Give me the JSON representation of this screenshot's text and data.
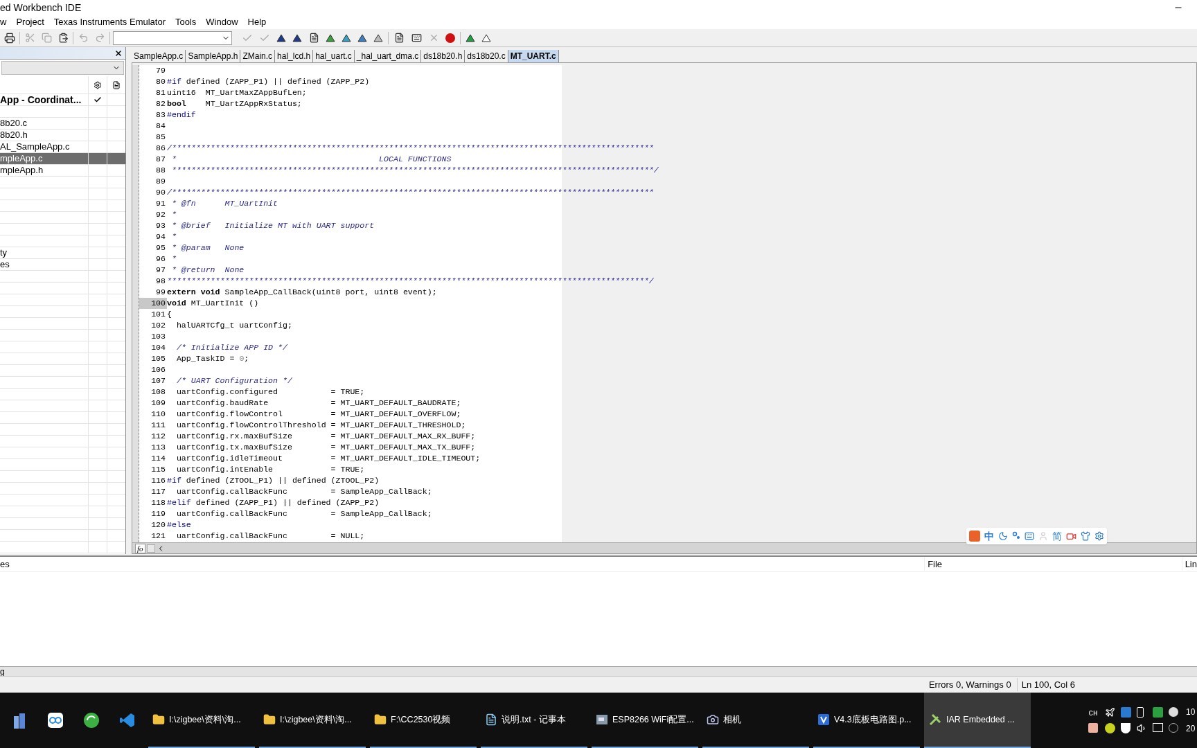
{
  "window": {
    "title": "ed Workbench IDE"
  },
  "menu": [
    "w",
    "Project",
    "Texas Instruments Emulator",
    "Tools",
    "Window",
    "Help"
  ],
  "workspace": {
    "project": {
      "label": "App - Coordinat...",
      "checked": true
    },
    "items": [
      {
        "label": "8b20.c",
        "selected": false
      },
      {
        "label": "8b20.h",
        "selected": false
      },
      {
        "label": "AL_SampleApp.c",
        "selected": false
      },
      {
        "label": "mpleApp.c",
        "selected": true
      },
      {
        "label": "mpleApp.h",
        "selected": false
      },
      {
        "label": "ty",
        "selected": false
      },
      {
        "label": "es",
        "selected": false
      }
    ]
  },
  "tabs": [
    {
      "label": "SampleApp.c",
      "selected": false
    },
    {
      "label": "SampleApp.h",
      "selected": false
    },
    {
      "label": "ZMain.c",
      "selected": false
    },
    {
      "label": "hal_lcd.h",
      "selected": false
    },
    {
      "label": "hal_uart.c",
      "selected": false
    },
    {
      "label": "_hal_uart_dma.c",
      "selected": false
    },
    {
      "label": "ds18b20.h",
      "selected": false
    },
    {
      "label": "ds18b20.c",
      "selected": false
    },
    {
      "label": "MT_UART.c",
      "selected": true
    }
  ],
  "code": [
    {
      "number": "79",
      "current": false
    },
    {
      "number": "80",
      "current": false,
      "parts": [
        {
          "kind": "directive",
          "text": "#if"
        },
        {
          "kind": "plain",
          "text": " defined (ZAPP_P1) || defined (ZAPP_P2)"
        }
      ]
    },
    {
      "number": "81",
      "current": false,
      "parts": [
        {
          "kind": "plain",
          "text": "uint16  MT_UartMaxZAppBufLen;"
        }
      ]
    },
    {
      "number": "82",
      "current": false,
      "parts": [
        {
          "kind": "keyword",
          "text": "bool"
        },
        {
          "kind": "plain",
          "text": "    MT_UartZAppRxStatus;"
        }
      ]
    },
    {
      "number": "83",
      "current": false,
      "parts": [
        {
          "kind": "directive",
          "text": "#endif"
        }
      ]
    },
    {
      "number": "84",
      "current": false
    },
    {
      "number": "85",
      "current": false
    },
    {
      "number": "86",
      "current": false,
      "parts": [
        {
          "kind": "comment",
          "text": "/****************************************************************************************************"
        }
      ]
    },
    {
      "number": "87",
      "current": false,
      "parts": [
        {
          "kind": "comment",
          "text": " *                                          LOCAL FUNCTIONS"
        }
      ]
    },
    {
      "number": "88",
      "current": false,
      "parts": [
        {
          "kind": "comment",
          "text": " ****************************************************************************************************/"
        }
      ]
    },
    {
      "number": "89",
      "current": false
    },
    {
      "number": "90",
      "current": false,
      "parts": [
        {
          "kind": "comment",
          "text": "/****************************************************************************************************"
        }
      ]
    },
    {
      "number": "91",
      "current": false,
      "parts": [
        {
          "kind": "comment",
          "text": " * @fn      MT_UartInit"
        }
      ]
    },
    {
      "number": "92",
      "current": false,
      "parts": [
        {
          "kind": "comment",
          "text": " *"
        }
      ]
    },
    {
      "number": "93",
      "current": false,
      "parts": [
        {
          "kind": "comment",
          "text": " * @brief   Initialize MT with UART support"
        }
      ]
    },
    {
      "number": "94",
      "current": false,
      "parts": [
        {
          "kind": "comment",
          "text": " *"
        }
      ]
    },
    {
      "number": "95",
      "current": false,
      "parts": [
        {
          "kind": "comment",
          "text": " * @param   None"
        }
      ]
    },
    {
      "number": "96",
      "current": false,
      "parts": [
        {
          "kind": "comment",
          "text": " *"
        }
      ]
    },
    {
      "number": "97",
      "current": false,
      "parts": [
        {
          "kind": "comment",
          "text": " * @return  None"
        }
      ]
    },
    {
      "number": "98",
      "current": false,
      "parts": [
        {
          "kind": "comment",
          "text": "****************************************************************************************************/"
        }
      ]
    },
    {
      "number": "99",
      "current": false,
      "parts": [
        {
          "kind": "keyword",
          "text": "extern void"
        },
        {
          "kind": "plain",
          "text": " SampleApp_CallBack(uint8 port, uint8 event);"
        }
      ]
    },
    {
      "number": "100",
      "current": true,
      "parts": [
        {
          "kind": "keyword",
          "text": "void"
        },
        {
          "kind": "plain",
          "text": " MT_UartInit ()"
        }
      ]
    },
    {
      "number": "101",
      "current": false,
      "parts": [
        {
          "kind": "plain",
          "text": "{"
        }
      ]
    },
    {
      "number": "102",
      "current": false,
      "parts": [
        {
          "kind": "plain",
          "text": "  halUARTCfg_t uartConfig;"
        }
      ]
    },
    {
      "number": "103",
      "current": false
    },
    {
      "number": "104",
      "current": false,
      "parts": [
        {
          "kind": "comment",
          "text": "  /* Initialize APP ID */"
        }
      ]
    },
    {
      "number": "105",
      "current": false,
      "parts": [
        {
          "kind": "plain",
          "text": "  App_TaskID = "
        },
        {
          "kind": "number",
          "text": "0"
        },
        {
          "kind": "plain",
          "text": ";"
        }
      ]
    },
    {
      "number": "106",
      "current": false
    },
    {
      "number": "107",
      "current": false,
      "parts": [
        {
          "kind": "comment",
          "text": "  /* UART Configuration */"
        }
      ]
    },
    {
      "number": "108",
      "current": false,
      "parts": [
        {
          "kind": "plain",
          "text": "  uartConfig.configured           = TRUE;"
        }
      ]
    },
    {
      "number": "109",
      "current": false,
      "parts": [
        {
          "kind": "plain",
          "text": "  uartConfig.baudRate             = MT_UART_DEFAULT_BAUDRATE;"
        }
      ]
    },
    {
      "number": "110",
      "current": false,
      "parts": [
        {
          "kind": "plain",
          "text": "  uartConfig.flowControl          = MT_UART_DEFAULT_OVERFLOW;"
        }
      ]
    },
    {
      "number": "111",
      "current": false,
      "parts": [
        {
          "kind": "plain",
          "text": "  uartConfig.flowControlThreshold = MT_UART_DEFAULT_THRESHOLD;"
        }
      ]
    },
    {
      "number": "112",
      "current": false,
      "parts": [
        {
          "kind": "plain",
          "text": "  uartConfig.rx.maxBufSize        = MT_UART_DEFAULT_MAX_RX_BUFF;"
        }
      ]
    },
    {
      "number": "113",
      "current": false,
      "parts": [
        {
          "kind": "plain",
          "text": "  uartConfig.tx.maxBufSize        = MT_UART_DEFAULT_MAX_TX_BUFF;"
        }
      ]
    },
    {
      "number": "114",
      "current": false,
      "parts": [
        {
          "kind": "plain",
          "text": "  uartConfig.idleTimeout          = MT_UART_DEFAULT_IDLE_TIMEOUT;"
        }
      ]
    },
    {
      "number": "115",
      "current": false,
      "parts": [
        {
          "kind": "plain",
          "text": "  uartConfig.intEnable            = TRUE;"
        }
      ]
    },
    {
      "number": "116",
      "current": false,
      "parts": [
        {
          "kind": "directive",
          "text": "#if"
        },
        {
          "kind": "plain",
          "text": " defined (ZTOOL_P1) || defined (ZTOOL_P2)"
        }
      ]
    },
    {
      "number": "117",
      "current": false,
      "parts": [
        {
          "kind": "plain",
          "text": "  uartConfig.callBackFunc         = SampleApp_CallBack;"
        }
      ]
    },
    {
      "number": "118",
      "current": false,
      "parts": [
        {
          "kind": "directive",
          "text": "#elif"
        },
        {
          "kind": "plain",
          "text": " defined (ZAPP_P1) || defined (ZAPP_P2)"
        }
      ]
    },
    {
      "number": "119",
      "current": false,
      "parts": [
        {
          "kind": "plain",
          "text": "  uartConfig.callBackFunc         = SampleApp_CallBack;"
        }
      ]
    },
    {
      "number": "120",
      "current": false,
      "parts": [
        {
          "kind": "directive",
          "text": "#else"
        }
      ]
    },
    {
      "number": "121",
      "current": false,
      "parts": [
        {
          "kind": "plain",
          "text": "  uartConfig.callBackFunc         = NULL;"
        }
      ]
    }
  ],
  "scroll_label": "fo",
  "ime_bar": {
    "mode": "中",
    "script": "简"
  },
  "output": {
    "columns": [
      "es",
      "File",
      "Lin"
    ],
    "tab": "g"
  },
  "status_bar": {
    "errors": "Errors 0, Warnings 0",
    "position": "Ln 100, Col 6"
  },
  "taskbar": {
    "windows": [
      {
        "label": "I:\\zigbee\\资料\\淘...",
        "kind": "folder",
        "selected": false
      },
      {
        "label": "I:\\zigbee\\资料\\淘...",
        "kind": "folder",
        "selected": false
      },
      {
        "label": "F:\\CC2530视频",
        "kind": "folder",
        "selected": false
      },
      {
        "label": "说明.txt - 记事本",
        "kind": "notepad",
        "selected": false
      },
      {
        "label": "ESP8266 WiFi配置...",
        "kind": "app",
        "selected": false
      },
      {
        "label": "相机",
        "kind": "camera",
        "selected": false
      },
      {
        "label": "V4.3底板电路图.p...",
        "kind": "visio",
        "selected": false
      },
      {
        "label": "IAR Embedded ...",
        "kind": "iar",
        "selected": true
      }
    ],
    "language": "CH",
    "clock": [
      "10",
      "20"
    ]
  }
}
